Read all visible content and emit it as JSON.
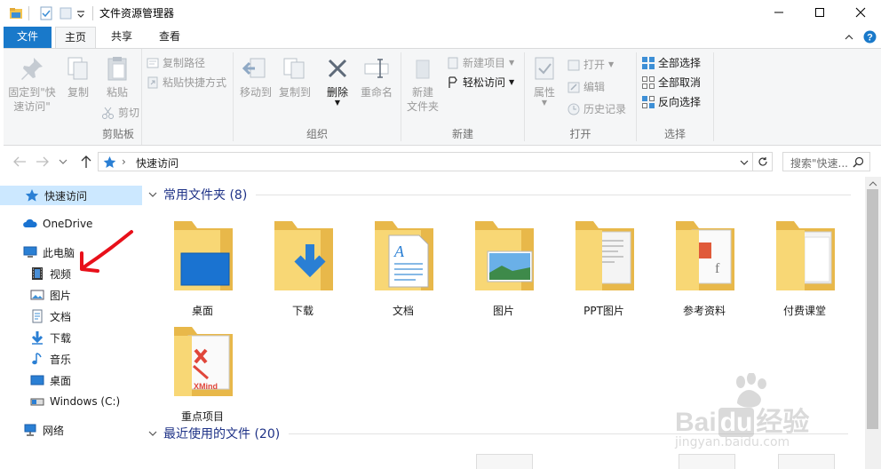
{
  "window": {
    "title": "文件资源管理器"
  },
  "ribbon_tabs": [
    "文件",
    "主页",
    "共享",
    "查看"
  ],
  "ribbon": {
    "clipboard": {
      "pin_label_1": "固定到\"快",
      "pin_label_2": "速访问\"",
      "copy": "复制",
      "paste": "粘贴",
      "copy_path": "复制路径",
      "paste_shortcut": "粘贴快捷方式",
      "cut": "剪切",
      "group": "剪贴板"
    },
    "organize": {
      "move_to": "移动到",
      "copy_to": "复制到",
      "delete": "删除",
      "rename": "重命名",
      "group": "组织"
    },
    "new": {
      "new_folder_1": "新建",
      "new_folder_2": "文件夹",
      "new_item": "新建项目",
      "easy_access": "轻松访问",
      "group": "新建"
    },
    "open": {
      "properties": "属性",
      "open": "打开",
      "edit": "编辑",
      "history": "历史记录",
      "group": "打开"
    },
    "select": {
      "select_all": "全部选择",
      "select_none": "全部取消",
      "invert": "反向选择",
      "group": "选择"
    }
  },
  "address": {
    "separator": "›",
    "location": "快速访问",
    "search_placeholder": "搜索\"快速..."
  },
  "nav": {
    "quick_access": "快速访问",
    "onedrive": "OneDrive",
    "this_pc": "此电脑",
    "videos": "视频",
    "pictures": "图片",
    "documents": "文档",
    "downloads": "下载",
    "music": "音乐",
    "desktop": "桌面",
    "drive_c": "Windows (C:)",
    "network": "网络"
  },
  "content": {
    "frequent_header": "常用文件夹 (8)",
    "recent_header": "最近使用的文件 (20)",
    "folders": [
      "桌面",
      "下载",
      "文档",
      "图片",
      "PPT图片",
      "参考资料",
      "付费课堂",
      "重点项目"
    ]
  },
  "watermark": {
    "brand_left": "Bai",
    "brand_mid": "du",
    "brand_right": "经验",
    "url": "jingyan.baidu.com"
  },
  "colors": {
    "accent": "#1979ca",
    "folder_yellow": "#f8d775",
    "folder_dark": "#e8b84a",
    "section_blue": "#1e3287",
    "annotation_red": "#e8101a"
  }
}
